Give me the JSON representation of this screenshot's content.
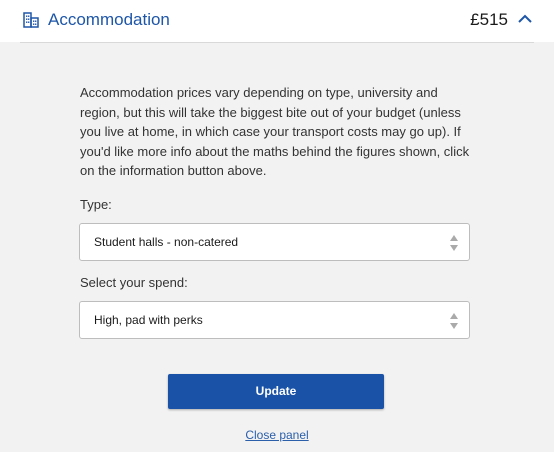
{
  "panel": {
    "title": "Accommodation",
    "amount": "£515",
    "icon": "building-icon",
    "toggle_icon": "chevron-up-icon",
    "accent_color": "#1e56a8"
  },
  "description": "Accommodation prices vary depending on type, university and region, but this will take the biggest bite out of your budget (unless you live at home, in which case your transport costs may go up). If you'd like more info about the maths behind the figures shown, click on the information button above.",
  "type_field": {
    "label": "Type:",
    "value": "Student halls - non-catered"
  },
  "spend_field": {
    "label": "Select your spend:",
    "value": "High, pad with perks"
  },
  "update_button": {
    "label": "Update",
    "color": "#1a52a8"
  },
  "close_link": "Close panel"
}
